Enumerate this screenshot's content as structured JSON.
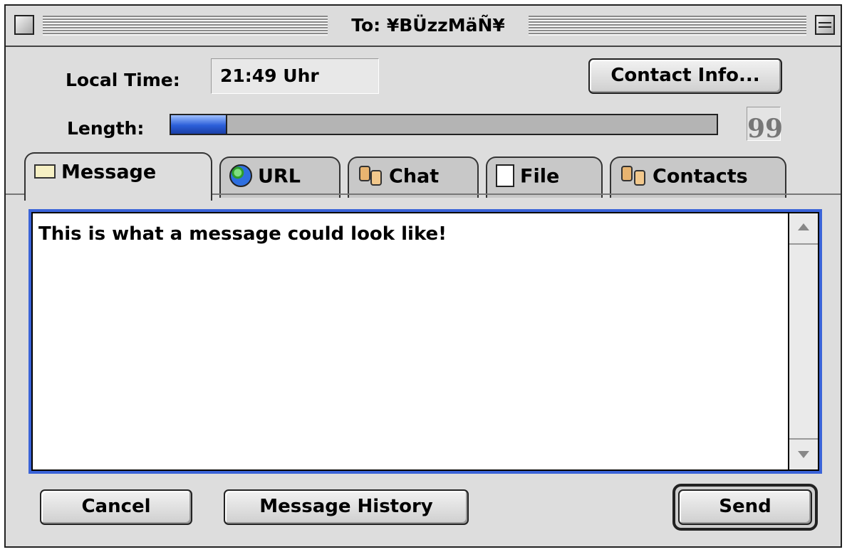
{
  "window": {
    "title": "To: ¥BÜzzMäÑ¥"
  },
  "header": {
    "local_time_label": "Local Time:",
    "local_time_value": "21:49 Uhr",
    "contact_info_button": "Contact Info...",
    "length_label": "Length:",
    "length_fraction": 0.1,
    "quote_symbol": "99"
  },
  "tabs": [
    {
      "label": "Message",
      "icon": "envelope-icon",
      "active": true
    },
    {
      "label": "URL",
      "icon": "globe-icon",
      "active": false
    },
    {
      "label": "Chat",
      "icon": "chat-faces-icon",
      "active": false
    },
    {
      "label": "File",
      "icon": "document-icon",
      "active": false
    },
    {
      "label": "Contacts",
      "icon": "contacts-exchange-icon",
      "active": false
    }
  ],
  "message": {
    "text": "This is what a message could look like!"
  },
  "footer": {
    "cancel_label": "Cancel",
    "history_label": "Message History",
    "send_label": "Send"
  },
  "colors": {
    "focus_ring": "#3a63d8",
    "progress_fill": "#2b5fd9",
    "window_bg": "#dddddd"
  }
}
